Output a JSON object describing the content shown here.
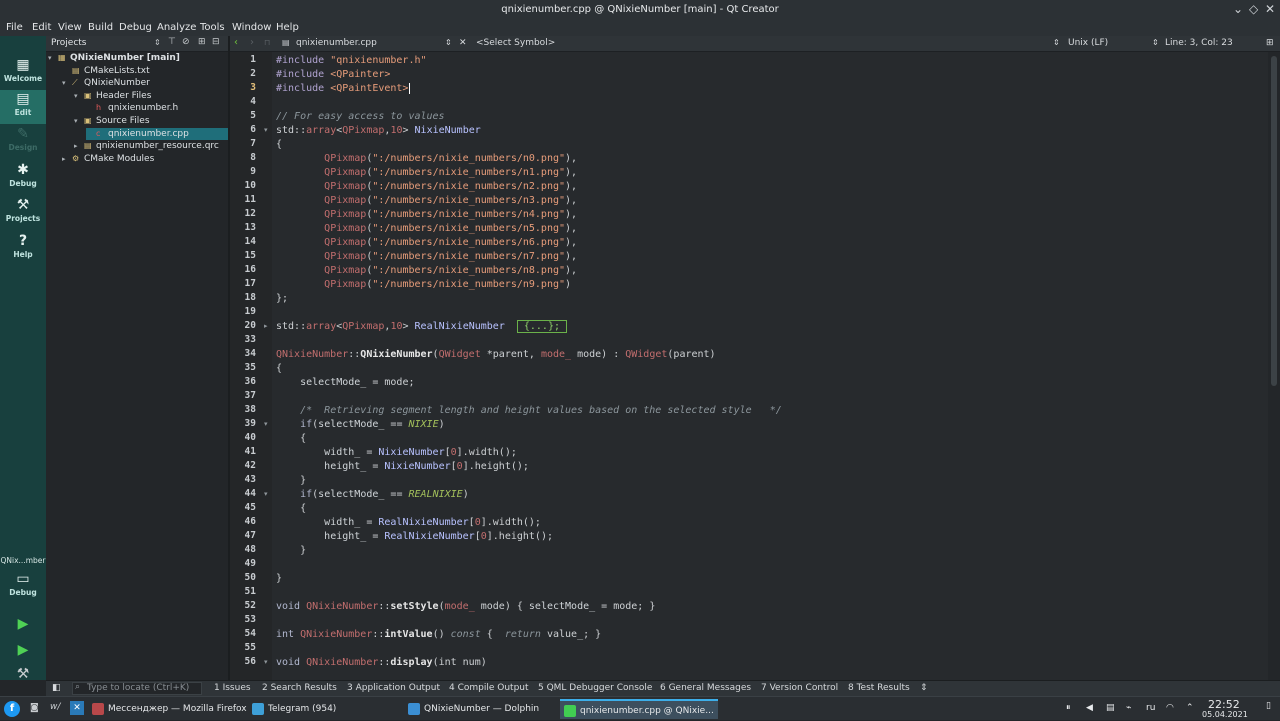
{
  "window": {
    "title": "qnixienumber.cpp @ QNixieNumber [main] - Qt Creator"
  },
  "menu": [
    "File",
    "Edit",
    "View",
    "Build",
    "Debug",
    "Analyze",
    "Tools",
    "Window",
    "Help"
  ],
  "modes": [
    {
      "label": "Welcome",
      "icon": "grid-icon"
    },
    {
      "label": "Edit",
      "icon": "document-icon"
    },
    {
      "label": "Design",
      "icon": "pen-icon"
    },
    {
      "label": "Debug",
      "icon": "bug-icon"
    },
    {
      "label": "Projects",
      "icon": "wrench-icon"
    },
    {
      "label": "Help",
      "icon": "help-icon"
    }
  ],
  "kit": {
    "project": "QNix...mber",
    "config": "Debug"
  },
  "projects": {
    "label": "Projects",
    "tree": [
      {
        "text": "QNixieNumber [main]",
        "arrow": "▾",
        "icon": "▦",
        "bold": true
      },
      {
        "text": "CMakeLists.txt",
        "arrow": "",
        "icon": "▤"
      },
      {
        "text": "QNixieNumber",
        "arrow": "▾",
        "icon": "⟋"
      },
      {
        "text": "Header Files",
        "arrow": "▾",
        "icon": "▣"
      },
      {
        "text": "qnixienumber.h",
        "arrow": "",
        "icon": "h"
      },
      {
        "text": "Source Files",
        "arrow": "▾",
        "icon": "▣"
      },
      {
        "text": "qnixienumber.cpp",
        "arrow": "",
        "icon": "c"
      },
      {
        "text": "qnixienumber_resource.qrc",
        "arrow": "▸",
        "icon": "▤"
      },
      {
        "text": "CMake Modules",
        "arrow": "▸",
        "icon": "⚙"
      }
    ]
  },
  "editor": {
    "file": "qnixienumber.cpp",
    "symbol": "<Select Symbol>",
    "line_ending": "Unix (LF)",
    "position": "Line: 3, Col: 23"
  },
  "code": [
    {
      "n": "1",
      "t": [
        [
          "pp",
          "#include "
        ],
        [
          "str",
          "\"qnixienumber.h\""
        ]
      ]
    },
    {
      "n": "2",
      "t": [
        [
          "pp",
          "#include "
        ],
        [
          "str",
          "<QPainter>"
        ]
      ]
    },
    {
      "n": "3",
      "t": [
        [
          "pp",
          "#include "
        ],
        [
          "str",
          "<QPaintEvent>"
        ]
      ]
    },
    {
      "n": "4",
      "t": []
    },
    {
      "n": "5",
      "t": [
        [
          "cm",
          "// For easy access to values"
        ]
      ]
    },
    {
      "n": "6",
      "f": "▾",
      "t": [
        [
          "df",
          "std::"
        ],
        [
          "ty",
          "array"
        ],
        [
          "df",
          "<"
        ],
        [
          "ty",
          "QPixmap"
        ],
        [
          "df",
          ","
        ],
        [
          "nu",
          "10"
        ],
        [
          "df",
          "> "
        ],
        [
          "fn",
          "NixieNumber"
        ]
      ]
    },
    {
      "n": "7",
      "t": [
        [
          "df",
          "{"
        ]
      ]
    },
    {
      "n": "8",
      "t": [
        [
          "df",
          "        "
        ],
        [
          "ty",
          "QPixmap"
        ],
        [
          "df",
          "("
        ],
        [
          "str",
          "\":/numbers/nixie_numbers/n0.png\""
        ],
        [
          "df",
          "),"
        ]
      ]
    },
    {
      "n": "9",
      "t": [
        [
          "df",
          "        "
        ],
        [
          "ty",
          "QPixmap"
        ],
        [
          "df",
          "("
        ],
        [
          "str",
          "\":/numbers/nixie_numbers/n1.png\""
        ],
        [
          "df",
          "),"
        ]
      ]
    },
    {
      "n": "10",
      "t": [
        [
          "df",
          "        "
        ],
        [
          "ty",
          "QPixmap"
        ],
        [
          "df",
          "("
        ],
        [
          "str",
          "\":/numbers/nixie_numbers/n2.png\""
        ],
        [
          "df",
          "),"
        ]
      ]
    },
    {
      "n": "11",
      "t": [
        [
          "df",
          "        "
        ],
        [
          "ty",
          "QPixmap"
        ],
        [
          "df",
          "("
        ],
        [
          "str",
          "\":/numbers/nixie_numbers/n3.png\""
        ],
        [
          "df",
          "),"
        ]
      ]
    },
    {
      "n": "12",
      "t": [
        [
          "df",
          "        "
        ],
        [
          "ty",
          "QPixmap"
        ],
        [
          "df",
          "("
        ],
        [
          "str",
          "\":/numbers/nixie_numbers/n4.png\""
        ],
        [
          "df",
          "),"
        ]
      ]
    },
    {
      "n": "13",
      "t": [
        [
          "df",
          "        "
        ],
        [
          "ty",
          "QPixmap"
        ],
        [
          "df",
          "("
        ],
        [
          "str",
          "\":/numbers/nixie_numbers/n5.png\""
        ],
        [
          "df",
          "),"
        ]
      ]
    },
    {
      "n": "14",
      "t": [
        [
          "df",
          "        "
        ],
        [
          "ty",
          "QPixmap"
        ],
        [
          "df",
          "("
        ],
        [
          "str",
          "\":/numbers/nixie_numbers/n6.png\""
        ],
        [
          "df",
          "),"
        ]
      ]
    },
    {
      "n": "15",
      "t": [
        [
          "df",
          "        "
        ],
        [
          "ty",
          "QPixmap"
        ],
        [
          "df",
          "("
        ],
        [
          "str",
          "\":/numbers/nixie_numbers/n7.png\""
        ],
        [
          "df",
          "),"
        ]
      ]
    },
    {
      "n": "16",
      "t": [
        [
          "df",
          "        "
        ],
        [
          "ty",
          "QPixmap"
        ],
        [
          "df",
          "("
        ],
        [
          "str",
          "\":/numbers/nixie_numbers/n8.png\""
        ],
        [
          "df",
          "),"
        ]
      ]
    },
    {
      "n": "17",
      "t": [
        [
          "df",
          "        "
        ],
        [
          "ty",
          "QPixmap"
        ],
        [
          "df",
          "("
        ],
        [
          "str",
          "\":/numbers/nixie_numbers/n9.png\""
        ],
        [
          "df",
          ")"
        ]
      ]
    },
    {
      "n": "18",
      "t": [
        [
          "df",
          "};"
        ]
      ]
    },
    {
      "n": "19",
      "t": []
    },
    {
      "n": "20",
      "f": "▸",
      "t": [
        [
          "df",
          "std::"
        ],
        [
          "ty",
          "array"
        ],
        [
          "df",
          "<"
        ],
        [
          "ty",
          "QPixmap"
        ],
        [
          "df",
          ","
        ],
        [
          "nu",
          "10"
        ],
        [
          "df",
          "> "
        ],
        [
          "fn",
          "RealNixieNumber "
        ]
      ],
      "box": "{...};"
    },
    {
      "n": "33",
      "t": []
    },
    {
      "n": "34",
      "t": [
        [
          "ty",
          "QNixieNumber"
        ],
        [
          "df",
          "::"
        ],
        [
          "bo",
          "QNixieNumber"
        ],
        [
          "df",
          "("
        ],
        [
          "ty",
          "QWidget"
        ],
        [
          "df",
          " *parent, "
        ],
        [
          "ty",
          "mode_"
        ],
        [
          "df",
          " mode) : "
        ],
        [
          "ty",
          "QWidget"
        ],
        [
          "df",
          "(parent)"
        ]
      ]
    },
    {
      "n": "35",
      "t": [
        [
          "df",
          "{"
        ]
      ]
    },
    {
      "n": "36",
      "t": [
        [
          "df",
          "    "
        ],
        [
          "mem",
          "selectMode_"
        ],
        [
          "df",
          " = mode;"
        ]
      ]
    },
    {
      "n": "37",
      "t": []
    },
    {
      "n": "38",
      "t": [
        [
          "df",
          "    "
        ],
        [
          "cm",
          "/*  Retrieving segment length and height values based on the selected style   */"
        ]
      ]
    },
    {
      "n": "39",
      "f": "▾",
      "t": [
        [
          "df",
          "    "
        ],
        [
          "kw",
          "if"
        ],
        [
          "df",
          "("
        ],
        [
          "mem",
          "selectMode_"
        ],
        [
          "df",
          " == "
        ],
        [
          "en",
          "NIXIE"
        ],
        [
          "df",
          ")"
        ]
      ]
    },
    {
      "n": "40",
      "t": [
        [
          "df",
          "    {"
        ]
      ]
    },
    {
      "n": "41",
      "t": [
        [
          "df",
          "        "
        ],
        [
          "mem",
          "width_"
        ],
        [
          "df",
          " = "
        ],
        [
          "fn",
          "NixieNumber"
        ],
        [
          "df",
          "["
        ],
        [
          "nu",
          "0"
        ],
        [
          "df",
          "].width();"
        ]
      ]
    },
    {
      "n": "42",
      "t": [
        [
          "df",
          "        "
        ],
        [
          "mem",
          "height_"
        ],
        [
          "df",
          " = "
        ],
        [
          "fn",
          "NixieNumber"
        ],
        [
          "df",
          "["
        ],
        [
          "nu",
          "0"
        ],
        [
          "df",
          "].height();"
        ]
      ]
    },
    {
      "n": "43",
      "t": [
        [
          "df",
          "    }"
        ]
      ]
    },
    {
      "n": "44",
      "f": "▾",
      "t": [
        [
          "df",
          "    "
        ],
        [
          "kw",
          "if"
        ],
        [
          "df",
          "("
        ],
        [
          "mem",
          "selectMode_"
        ],
        [
          "df",
          " == "
        ],
        [
          "en",
          "REALNIXIE"
        ],
        [
          "df",
          ")"
        ]
      ]
    },
    {
      "n": "45",
      "t": [
        [
          "df",
          "    {"
        ]
      ]
    },
    {
      "n": "46",
      "t": [
        [
          "df",
          "        "
        ],
        [
          "mem",
          "width_"
        ],
        [
          "df",
          " = "
        ],
        [
          "fn",
          "RealNixieNumber"
        ],
        [
          "df",
          "["
        ],
        [
          "nu",
          "0"
        ],
        [
          "df",
          "].width();"
        ]
      ]
    },
    {
      "n": "47",
      "t": [
        [
          "df",
          "        "
        ],
        [
          "mem",
          "height_"
        ],
        [
          "df",
          " = "
        ],
        [
          "fn",
          "RealNixieNumber"
        ],
        [
          "df",
          "["
        ],
        [
          "nu",
          "0"
        ],
        [
          "df",
          "].height();"
        ]
      ]
    },
    {
      "n": "48",
      "t": [
        [
          "df",
          "    }"
        ]
      ]
    },
    {
      "n": "49",
      "t": []
    },
    {
      "n": "50",
      "t": [
        [
          "df",
          "}"
        ]
      ]
    },
    {
      "n": "51",
      "t": []
    },
    {
      "n": "52",
      "t": [
        [
          "kw",
          "void "
        ],
        [
          "ty",
          "QNixieNumber"
        ],
        [
          "df",
          "::"
        ],
        [
          "bo",
          "setStyle"
        ],
        [
          "df",
          "("
        ],
        [
          "ty",
          "mode_"
        ],
        [
          "df",
          " mode) { "
        ],
        [
          "mem",
          "selectMode_"
        ],
        [
          "df",
          " = mode; }"
        ]
      ]
    },
    {
      "n": "53",
      "t": []
    },
    {
      "n": "54",
      "t": [
        [
          "kw",
          "int "
        ],
        [
          "ty",
          "QNixieNumber"
        ],
        [
          "df",
          "::"
        ],
        [
          "bo",
          "intValue"
        ],
        [
          "df",
          "() "
        ],
        [
          "cm",
          "const"
        ],
        [
          "df",
          " {  "
        ],
        [
          "cm",
          "return"
        ],
        [
          "df",
          " value_; }"
        ]
      ]
    },
    {
      "n": "55",
      "t": []
    },
    {
      "n": "56",
      "f": "▾",
      "t": [
        [
          "kw",
          "void "
        ],
        [
          "ty",
          "QNixieNumber"
        ],
        [
          "df",
          "::"
        ],
        [
          "bo",
          "display"
        ],
        [
          "df",
          "(int num)"
        ]
      ]
    }
  ],
  "output": {
    "locate_placeholder": "Type to locate (Ctrl+K)",
    "tabs": [
      "1  Issues",
      "2  Search Results",
      "3  Application Output",
      "4  Compile Output",
      "5  QML Debugger Console",
      "6  General Messages",
      "7  Version Control",
      "8  Test Results"
    ]
  },
  "taskbar": {
    "tasks": [
      {
        "label": "Мессенджер — Mozilla Firefox",
        "color": "#b8484a"
      },
      {
        "label": "Telegram (954)",
        "color": "#3ea0d8"
      },
      {
        "label": "QNixieNumber — Dolphin",
        "color": "#3b8fd4"
      },
      {
        "label": "qnixienumber.cpp @ QNixie...",
        "color": "#41cd52"
      }
    ],
    "lang": "ru",
    "time": "22:52",
    "date": "05.04.2021"
  }
}
